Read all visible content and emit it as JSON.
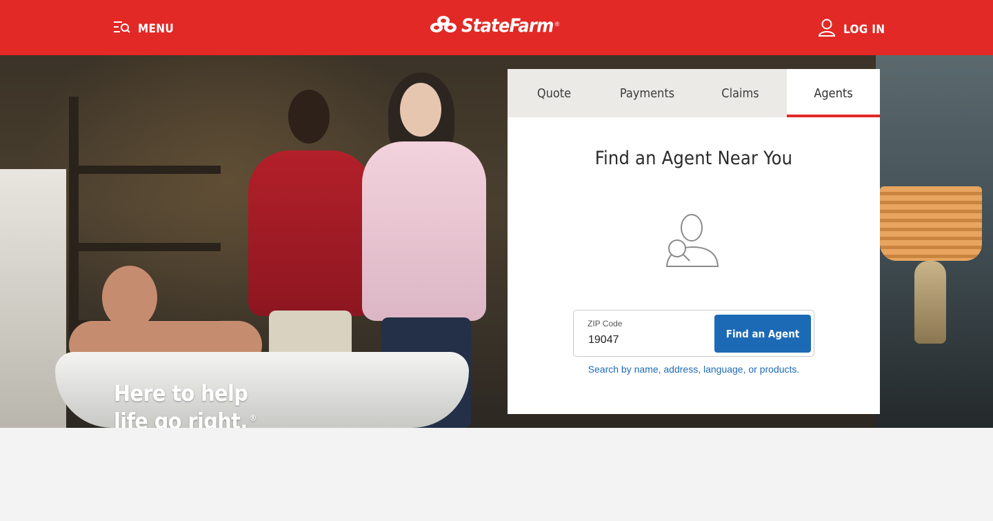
{
  "header": {
    "menu_label": "MENU",
    "brand": "StateFarm",
    "brand_reg": "®",
    "login_label": "LOG IN",
    "bg_color": "#e22926"
  },
  "hero": {
    "tagline_line1": "Here to help",
    "tagline_line2": "life go right.",
    "tagline_reg": "®"
  },
  "panel": {
    "tabs": [
      {
        "label": "Quote",
        "active": false
      },
      {
        "label": "Payments",
        "active": false
      },
      {
        "label": "Claims",
        "active": false
      },
      {
        "label": "Agents",
        "active": true
      }
    ],
    "title": "Find an Agent Near You",
    "agent_icon": "agent-search-icon",
    "zip_label": "ZIP Code",
    "zip_value": "19047",
    "find_button": "Find an Agent",
    "search_link": "Search by name, address, language, or products.",
    "accent_color": "#1c6ab5"
  }
}
